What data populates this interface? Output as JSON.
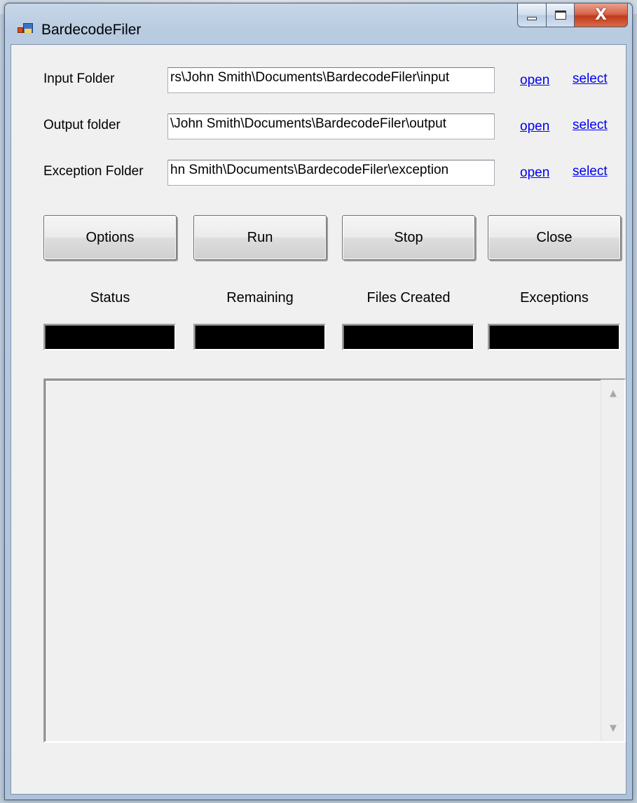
{
  "window": {
    "title": "BardecodeFiler",
    "icons": {
      "app": "app-icon",
      "minimize": "minimize-icon",
      "maximize": "maximize-icon",
      "close": "close-icon"
    },
    "close_glyph": "X"
  },
  "folders": [
    {
      "label": "Input Folder",
      "value": "rs\\John Smith\\Documents\\BardecodeFiler\\input",
      "open": "open",
      "select": "select"
    },
    {
      "label": "Output folder",
      "value": "\\John Smith\\Documents\\BardecodeFiler\\output",
      "open": "open",
      "select": "select"
    },
    {
      "label": "Exception Folder",
      "value": "hn Smith\\Documents\\BardecodeFiler\\exception",
      "open": "open",
      "select": "select"
    }
  ],
  "buttons": {
    "options": "Options",
    "run": "Run",
    "stop": "Stop",
    "close": "Close"
  },
  "stats": {
    "status_label": "Status",
    "remaining_label": "Remaining",
    "files_created_label": "Files Created",
    "exceptions_label": "Exceptions",
    "status_value": "",
    "remaining_value": "",
    "files_created_value": "",
    "exceptions_value": ""
  },
  "log": {
    "text": "",
    "scroll_up": "▲",
    "scroll_down": "▼"
  }
}
